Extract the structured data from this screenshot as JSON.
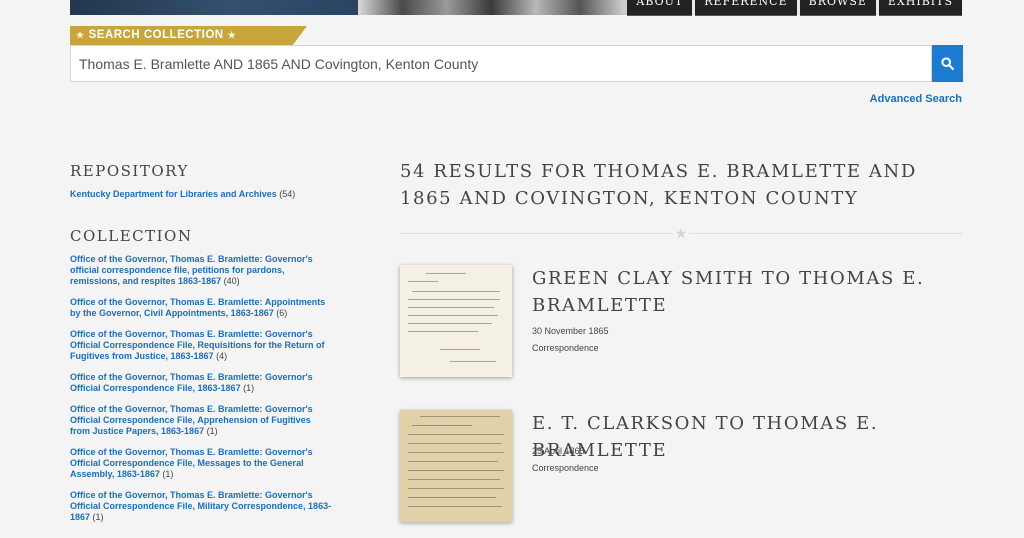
{
  "nav": {
    "items": [
      "ABOUT",
      "REFERENCE",
      "BROWSE",
      "EXHIBITS"
    ]
  },
  "search": {
    "label": "SEARCH COLLECTION",
    "query": "Thomas E. Bramlette AND 1865 AND Covington, Kenton County",
    "advanced_label": "Advanced Search",
    "button_icon": "search-icon"
  },
  "facets": {
    "repository": {
      "heading": "REPOSITORY",
      "items": [
        {
          "label": "Kentucky Department for Libraries and Archives",
          "count": "(54)"
        }
      ]
    },
    "collection": {
      "heading": "COLLECTION",
      "items": [
        {
          "label": "Office of the Governor, Thomas E. Bramlette: Governor's official correspondence file, petitions for pardons, remissions, and respites 1863-1867",
          "count": "(40)"
        },
        {
          "label": "Office of the Governor, Thomas E. Bramlette: Appointments by the Governor, Civil Appointments, 1863-1867",
          "count": "(6)"
        },
        {
          "label": "Office of the Governor, Thomas E. Bramlette: Governor's Official Correspondence File, Requisitions for the Return of Fugitives from Justice, 1863-1867",
          "count": "(4)"
        },
        {
          "label": "Office of the Governor, Thomas E. Bramlette: Governor's Official Correspondence File, 1863-1867",
          "count": "(1)"
        },
        {
          "label": "Office of the Governor, Thomas E. Bramlette: Governor's Official Correspondence File, Apprehension of Fugitives from Justice Papers, 1863-1867",
          "count": "(1)"
        },
        {
          "label": "Office of the Governor, Thomas E. Bramlette: Governor's Official Correspondence File, Messages to the General Assembly, 1863-1867",
          "count": "(1)"
        },
        {
          "label": "Office of the Governor, Thomas E. Bramlette: Governor's Official Correspondence File, Military Correspondence, 1863-1867",
          "count": "(1)"
        }
      ]
    }
  },
  "results": {
    "heading": "54 RESULTS FOR THOMAS E. BRAMLETTE AND 1865 AND COVINGTON, KENTON COUNTY",
    "divider_icon": "star-icon",
    "items": [
      {
        "title": "GREEN CLAY SMITH TO THOMAS E. BRAMLETTE",
        "date": "30 November 1865",
        "type": "Correspondence"
      },
      {
        "title": "E. T. CLARKSON TO THOMAS E. BRAMLETTE",
        "date": "25 April 1865",
        "type": "Correspondence"
      }
    ]
  }
}
